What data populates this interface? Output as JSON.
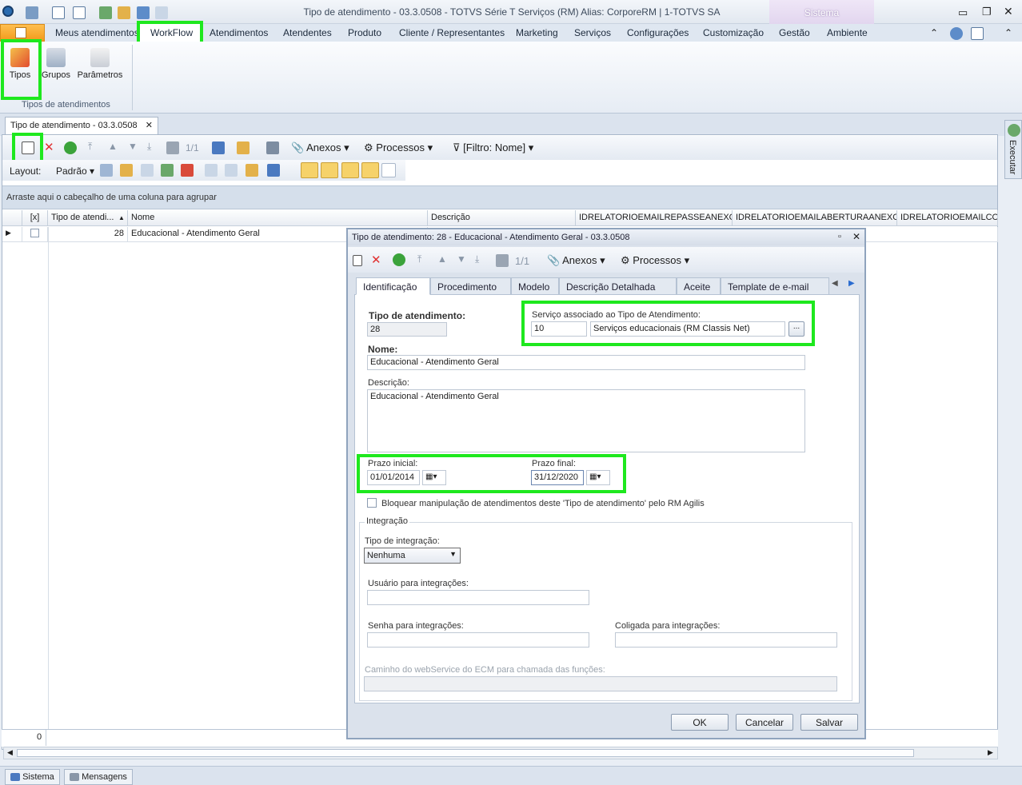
{
  "window": {
    "title": "Tipo de atendimento - 03.3.0508 - TOTVS Série T Serviços (RM) Alias: CorporeRM | 1-TOTVS SA",
    "context_tab": "Sistema"
  },
  "ribbon": {
    "tabs": [
      "Meus atendimentos",
      "WorkFlow",
      "Atendimentos",
      "Atendentes",
      "Produto",
      "Cliente / Representantes",
      "Marketing",
      "Serviços",
      "Configurações",
      "Customização",
      "Gestão",
      "Ambiente"
    ],
    "buttons": [
      "Tipos",
      "Grupos",
      "Parâmetros"
    ],
    "group_label": "Tipos de atendimentos"
  },
  "doc_tab": {
    "label": "Tipo de atendimento - 03.3.0508"
  },
  "grid_toolbar": {
    "page_counter": "1/1",
    "anexos": "Anexos",
    "processos": "Processos",
    "filter": "[Filtro: Nome]",
    "layout_label": "Layout:",
    "layout_value": "Padrão"
  },
  "group_hint": "Arraste aqui o cabeçalho de uma coluna para agrupar",
  "grid": {
    "columns": [
      "[x]",
      "Tipo de atendi...",
      "Nome",
      "Descrição",
      "IDRELATORIOEMAILREPASSEANEXO",
      "IDRELATORIOEMAILABERTURAANEXO",
      "IDRELATORIOEMAILCON"
    ],
    "row": {
      "tipo": "28",
      "nome": "Educacional - Atendimento Geral"
    },
    "footer_count": "0"
  },
  "right_panel": {
    "label": "Executar"
  },
  "bottom_tabs": [
    "Sistema",
    "Mensagens"
  ],
  "dialog": {
    "title": "Tipo de atendimento: 28 - Educacional - Atendimento Geral - 03.3.0508",
    "page_counter": "1/1",
    "anexos": "Anexos",
    "processos": "Processos",
    "tabs": [
      "Identificação",
      "Procedimento",
      "Modelo",
      "Descrição Detalhada",
      "Aceite",
      "Template de e-mail"
    ],
    "form": {
      "tipo_label": "Tipo de atendimento:",
      "tipo_value": "28",
      "servico_label": "Serviço associado ao Tipo de Atendimento:",
      "servico_code": "10",
      "servico_desc": "Serviços educacionais (RM Classis Net)",
      "ellipsis": "...",
      "nome_label": "Nome:",
      "nome_value": "Educacional - Atendimento Geral",
      "descricao_label": "Descrição:",
      "descricao_value": "Educacional - Atendimento Geral",
      "prazo_inicial_label": "Prazo inicial:",
      "prazo_inicial_value": "01/01/2014",
      "prazo_final_label": "Prazo final:",
      "prazo_final_value": "31/12/2020",
      "bloquear_label": "Bloquear manipulação de atendimentos deste 'Tipo de atendimento' pelo RM Agilis",
      "integracao_group": "Integração",
      "tipo_integracao_label": "Tipo de integração:",
      "tipo_integracao_value": "Nenhuma",
      "usuario_label": "Usuário para integrações:",
      "senha_label": "Senha para integrações:",
      "coligada_label": "Coligada para integrações:",
      "caminho_label": "Caminho do webService do ECM para chamada das funções:"
    },
    "buttons": {
      "ok": "OK",
      "cancel": "Cancelar",
      "save": "Salvar"
    }
  },
  "colors": {
    "highlight": "#1ee81e",
    "accent": "#f5a623"
  }
}
